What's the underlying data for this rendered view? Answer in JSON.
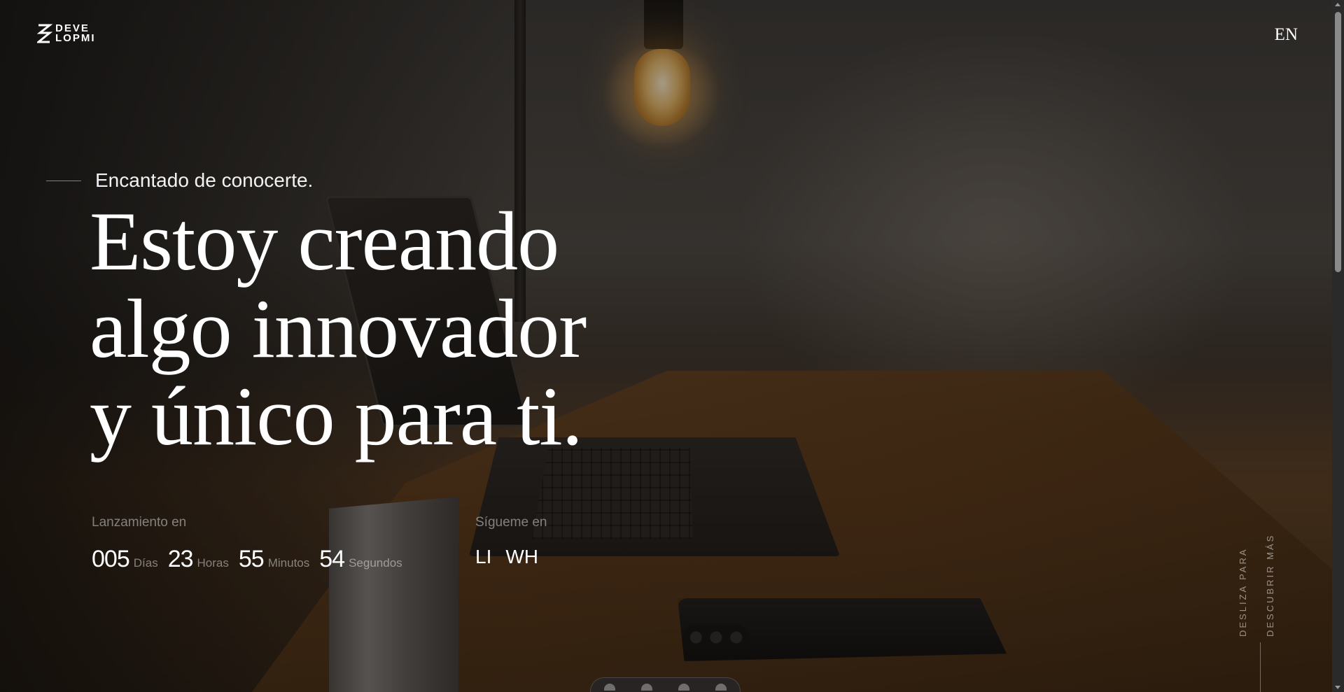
{
  "brand": {
    "logo_line1": "DEVE",
    "logo_line2": "LOPMI",
    "logo_icon": "zigzag-logo-icon"
  },
  "header": {
    "language_label": "EN"
  },
  "hero": {
    "intro": "Encantado de conocerte.",
    "headline_lines": [
      "Estoy creando",
      "algo innovador",
      "y único para ti."
    ]
  },
  "launch": {
    "label": "Lanzamiento en",
    "units": [
      {
        "value": "005",
        "label": "Días"
      },
      {
        "value": "23",
        "label": "Horas"
      },
      {
        "value": "55",
        "label": "Minutos"
      },
      {
        "value": "54",
        "label": "Segundos"
      }
    ]
  },
  "social": {
    "label": "Sígueme en",
    "links": [
      "LI",
      "WH"
    ]
  },
  "scroll_hint": {
    "line1": "DESLIZA PARA",
    "line2": "DESCUBRIR MÁS"
  },
  "colors": {
    "text": "#ffffff",
    "muted": "rgba(255,255,255,0.45)",
    "lamp_glow": "#e0b468",
    "wood": "#553517"
  }
}
